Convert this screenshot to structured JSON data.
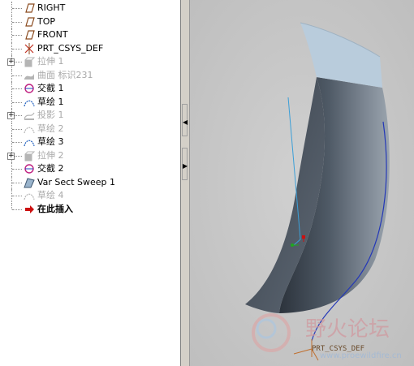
{
  "model_tree": {
    "items": [
      {
        "label": "RIGHT",
        "icon": "datum-plane-icon",
        "dim": false,
        "expandable": false
      },
      {
        "label": "TOP",
        "icon": "datum-plane-icon",
        "dim": false,
        "expandable": false
      },
      {
        "label": "FRONT",
        "icon": "datum-plane-icon",
        "dim": false,
        "expandable": false
      },
      {
        "label": "PRT_CSYS_DEF",
        "icon": "coordinate-system-icon",
        "dim": false,
        "expandable": false
      },
      {
        "label": "拉伸 1",
        "icon": "extrude-icon",
        "dim": true,
        "expandable": true
      },
      {
        "label": "曲面 标识231",
        "icon": "surface-icon",
        "dim": true,
        "expandable": false
      },
      {
        "label": "交截 1",
        "icon": "intersect-icon",
        "dim": false,
        "expandable": false
      },
      {
        "label": "草绘 1",
        "icon": "sketch-icon",
        "dim": false,
        "expandable": false
      },
      {
        "label": "投影 1",
        "icon": "projection-icon",
        "dim": true,
        "expandable": true
      },
      {
        "label": "草绘 2",
        "icon": "sketch-icon",
        "dim": true,
        "expandable": false
      },
      {
        "label": "草绘 3",
        "icon": "sketch-icon",
        "dim": false,
        "expandable": false
      },
      {
        "label": "拉伸 2",
        "icon": "extrude-icon",
        "dim": true,
        "expandable": true
      },
      {
        "label": "交截 2",
        "icon": "intersect-icon",
        "dim": false,
        "expandable": false
      },
      {
        "label": "Var Sect Sweep 1",
        "icon": "var-sect-sweep-icon",
        "dim": false,
        "expandable": false
      },
      {
        "label": "草绘 4",
        "icon": "sketch-icon",
        "dim": true,
        "expandable": false
      },
      {
        "label": "在此插入",
        "icon": "insert-here-arrow-icon",
        "dim": false,
        "expandable": false
      }
    ]
  },
  "viewport": {
    "csys_label": "PRT_CSYS_DEF",
    "watermark_title": "野火论坛",
    "watermark_url": "www.proewildfire.cn"
  },
  "colors": {
    "surface_top": "#b9ccdc",
    "surface_dark": "#48525e",
    "curve_blue": "#2438b8",
    "sketch_line": "#3b9fd8",
    "insert_arrow": "#cc1010",
    "datum_plane": "#8a4a1e"
  }
}
